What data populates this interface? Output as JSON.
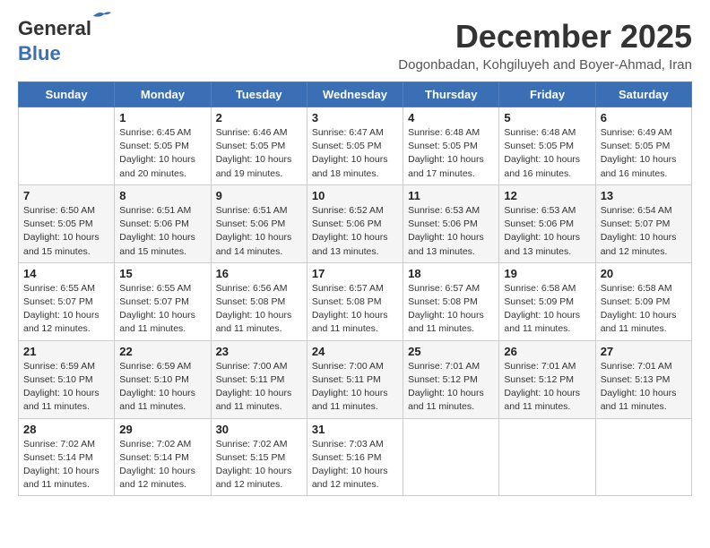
{
  "header": {
    "logo_line1": "General",
    "logo_line2": "Blue",
    "month": "December 2025",
    "location": "Dogonbadan, Kohgiluyeh and Boyer-Ahmad, Iran"
  },
  "weekdays": [
    "Sunday",
    "Monday",
    "Tuesday",
    "Wednesday",
    "Thursday",
    "Friday",
    "Saturday"
  ],
  "weeks": [
    [
      {
        "day": "",
        "info": ""
      },
      {
        "day": "1",
        "info": "Sunrise: 6:45 AM\nSunset: 5:05 PM\nDaylight: 10 hours\nand 20 minutes."
      },
      {
        "day": "2",
        "info": "Sunrise: 6:46 AM\nSunset: 5:05 PM\nDaylight: 10 hours\nand 19 minutes."
      },
      {
        "day": "3",
        "info": "Sunrise: 6:47 AM\nSunset: 5:05 PM\nDaylight: 10 hours\nand 18 minutes."
      },
      {
        "day": "4",
        "info": "Sunrise: 6:48 AM\nSunset: 5:05 PM\nDaylight: 10 hours\nand 17 minutes."
      },
      {
        "day": "5",
        "info": "Sunrise: 6:48 AM\nSunset: 5:05 PM\nDaylight: 10 hours\nand 16 minutes."
      },
      {
        "day": "6",
        "info": "Sunrise: 6:49 AM\nSunset: 5:05 PM\nDaylight: 10 hours\nand 16 minutes."
      }
    ],
    [
      {
        "day": "7",
        "info": "Sunrise: 6:50 AM\nSunset: 5:05 PM\nDaylight: 10 hours\nand 15 minutes."
      },
      {
        "day": "8",
        "info": "Sunrise: 6:51 AM\nSunset: 5:06 PM\nDaylight: 10 hours\nand 15 minutes."
      },
      {
        "day": "9",
        "info": "Sunrise: 6:51 AM\nSunset: 5:06 PM\nDaylight: 10 hours\nand 14 minutes."
      },
      {
        "day": "10",
        "info": "Sunrise: 6:52 AM\nSunset: 5:06 PM\nDaylight: 10 hours\nand 13 minutes."
      },
      {
        "day": "11",
        "info": "Sunrise: 6:53 AM\nSunset: 5:06 PM\nDaylight: 10 hours\nand 13 minutes."
      },
      {
        "day": "12",
        "info": "Sunrise: 6:53 AM\nSunset: 5:06 PM\nDaylight: 10 hours\nand 13 minutes."
      },
      {
        "day": "13",
        "info": "Sunrise: 6:54 AM\nSunset: 5:07 PM\nDaylight: 10 hours\nand 12 minutes."
      }
    ],
    [
      {
        "day": "14",
        "info": "Sunrise: 6:55 AM\nSunset: 5:07 PM\nDaylight: 10 hours\nand 12 minutes."
      },
      {
        "day": "15",
        "info": "Sunrise: 6:55 AM\nSunset: 5:07 PM\nDaylight: 10 hours\nand 11 minutes."
      },
      {
        "day": "16",
        "info": "Sunrise: 6:56 AM\nSunset: 5:08 PM\nDaylight: 10 hours\nand 11 minutes."
      },
      {
        "day": "17",
        "info": "Sunrise: 6:57 AM\nSunset: 5:08 PM\nDaylight: 10 hours\nand 11 minutes."
      },
      {
        "day": "18",
        "info": "Sunrise: 6:57 AM\nSunset: 5:08 PM\nDaylight: 10 hours\nand 11 minutes."
      },
      {
        "day": "19",
        "info": "Sunrise: 6:58 AM\nSunset: 5:09 PM\nDaylight: 10 hours\nand 11 minutes."
      },
      {
        "day": "20",
        "info": "Sunrise: 6:58 AM\nSunset: 5:09 PM\nDaylight: 10 hours\nand 11 minutes."
      }
    ],
    [
      {
        "day": "21",
        "info": "Sunrise: 6:59 AM\nSunset: 5:10 PM\nDaylight: 10 hours\nand 11 minutes."
      },
      {
        "day": "22",
        "info": "Sunrise: 6:59 AM\nSunset: 5:10 PM\nDaylight: 10 hours\nand 11 minutes."
      },
      {
        "day": "23",
        "info": "Sunrise: 7:00 AM\nSunset: 5:11 PM\nDaylight: 10 hours\nand 11 minutes."
      },
      {
        "day": "24",
        "info": "Sunrise: 7:00 AM\nSunset: 5:11 PM\nDaylight: 10 hours\nand 11 minutes."
      },
      {
        "day": "25",
        "info": "Sunrise: 7:01 AM\nSunset: 5:12 PM\nDaylight: 10 hours\nand 11 minutes."
      },
      {
        "day": "26",
        "info": "Sunrise: 7:01 AM\nSunset: 5:12 PM\nDaylight: 10 hours\nand 11 minutes."
      },
      {
        "day": "27",
        "info": "Sunrise: 7:01 AM\nSunset: 5:13 PM\nDaylight: 10 hours\nand 11 minutes."
      }
    ],
    [
      {
        "day": "28",
        "info": "Sunrise: 7:02 AM\nSunset: 5:14 PM\nDaylight: 10 hours\nand 11 minutes."
      },
      {
        "day": "29",
        "info": "Sunrise: 7:02 AM\nSunset: 5:14 PM\nDaylight: 10 hours\nand 12 minutes."
      },
      {
        "day": "30",
        "info": "Sunrise: 7:02 AM\nSunset: 5:15 PM\nDaylight: 10 hours\nand 12 minutes."
      },
      {
        "day": "31",
        "info": "Sunrise: 7:03 AM\nSunset: 5:16 PM\nDaylight: 10 hours\nand 12 minutes."
      },
      {
        "day": "",
        "info": ""
      },
      {
        "day": "",
        "info": ""
      },
      {
        "day": "",
        "info": ""
      }
    ]
  ]
}
